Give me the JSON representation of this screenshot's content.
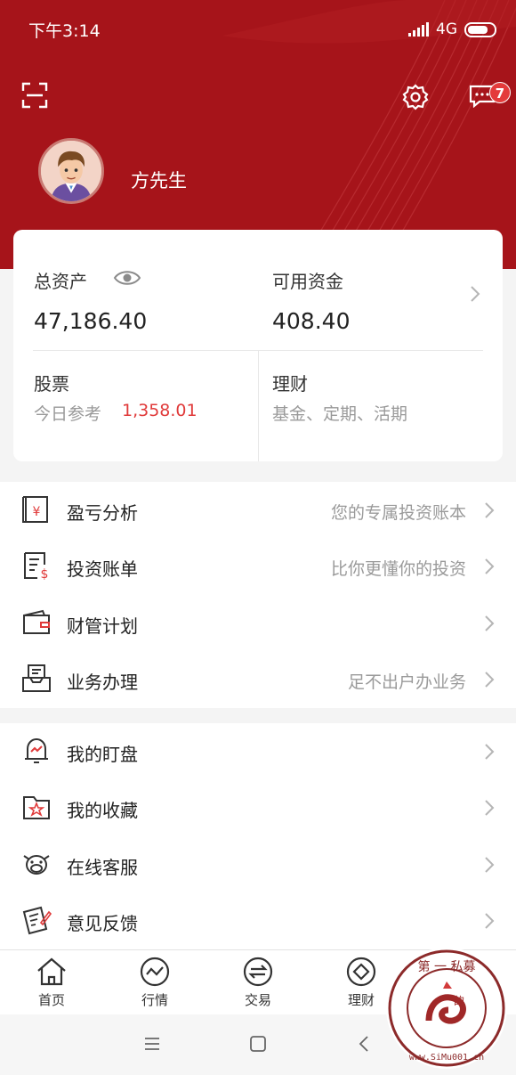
{
  "status_bar": {
    "time": "下午3:14",
    "network": "4G"
  },
  "header": {
    "username": "方先生",
    "message_badge": "7",
    "colors": {
      "primary": "#a6141a",
      "accent": "#e03a3a"
    }
  },
  "assets": {
    "total_label": "总资产",
    "total_value": "47,186.40",
    "available_label": "可用资金",
    "available_value": "408.40",
    "stock_label": "股票",
    "stock_sub_label": "今日参考",
    "stock_sub_value": "1,358.01",
    "finance_label": "理财",
    "finance_sub": "基金、定期、活期"
  },
  "menu1": [
    {
      "icon": "profit-analysis-icon",
      "title": "盈亏分析",
      "desc": "您的专属投资账本"
    },
    {
      "icon": "investment-bill-icon",
      "title": "投资账单",
      "desc": "比你更懂你的投资"
    },
    {
      "icon": "wallet-plan-icon",
      "title": "财管计划",
      "desc": ""
    },
    {
      "icon": "business-handling-icon",
      "title": "业务办理",
      "desc": "足不出户办业务"
    }
  ],
  "menu2": [
    {
      "icon": "bell-alert-icon",
      "title": "我的盯盘"
    },
    {
      "icon": "favorites-icon",
      "title": "我的收藏"
    },
    {
      "icon": "customer-service-icon",
      "title": "在线客服"
    },
    {
      "icon": "feedback-icon",
      "title": "意见反馈"
    }
  ],
  "tabs": [
    {
      "icon": "home-icon",
      "label": "首页"
    },
    {
      "icon": "market-icon",
      "label": "行情"
    },
    {
      "icon": "trade-icon",
      "label": "交易"
    },
    {
      "icon": "finance-icon",
      "label": "理财"
    }
  ],
  "watermark": {
    "text": "第一私募 的 www.SiMu001.cn"
  }
}
